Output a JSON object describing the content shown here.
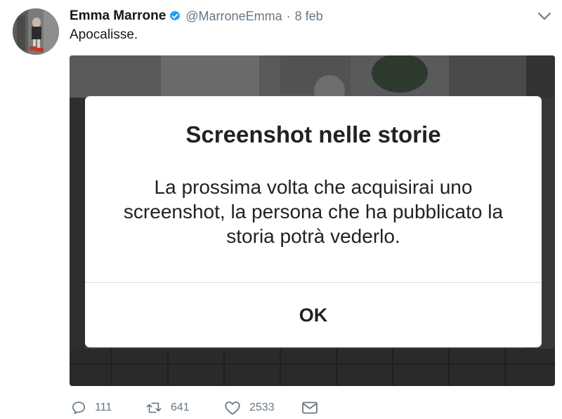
{
  "author": {
    "display_name": "Emma Marrone",
    "handle": "@MarroneEmma",
    "separator": "·",
    "date": "8 feb",
    "verified": true
  },
  "tweet": {
    "text": "Apocalisse."
  },
  "media": {
    "dialog": {
      "title": "Screenshot nelle storie",
      "body": "La prossima volta che acquisirai uno screenshot, la persona che ha pubblicato la storia potrà vederlo.",
      "button_label": "OK"
    }
  },
  "actions": {
    "reply_count": "111",
    "retweet_count": "641",
    "like_count": "2533"
  },
  "colors": {
    "verified": "#1da1f2",
    "secondary_text": "#657786",
    "primary_text": "#14171a"
  }
}
